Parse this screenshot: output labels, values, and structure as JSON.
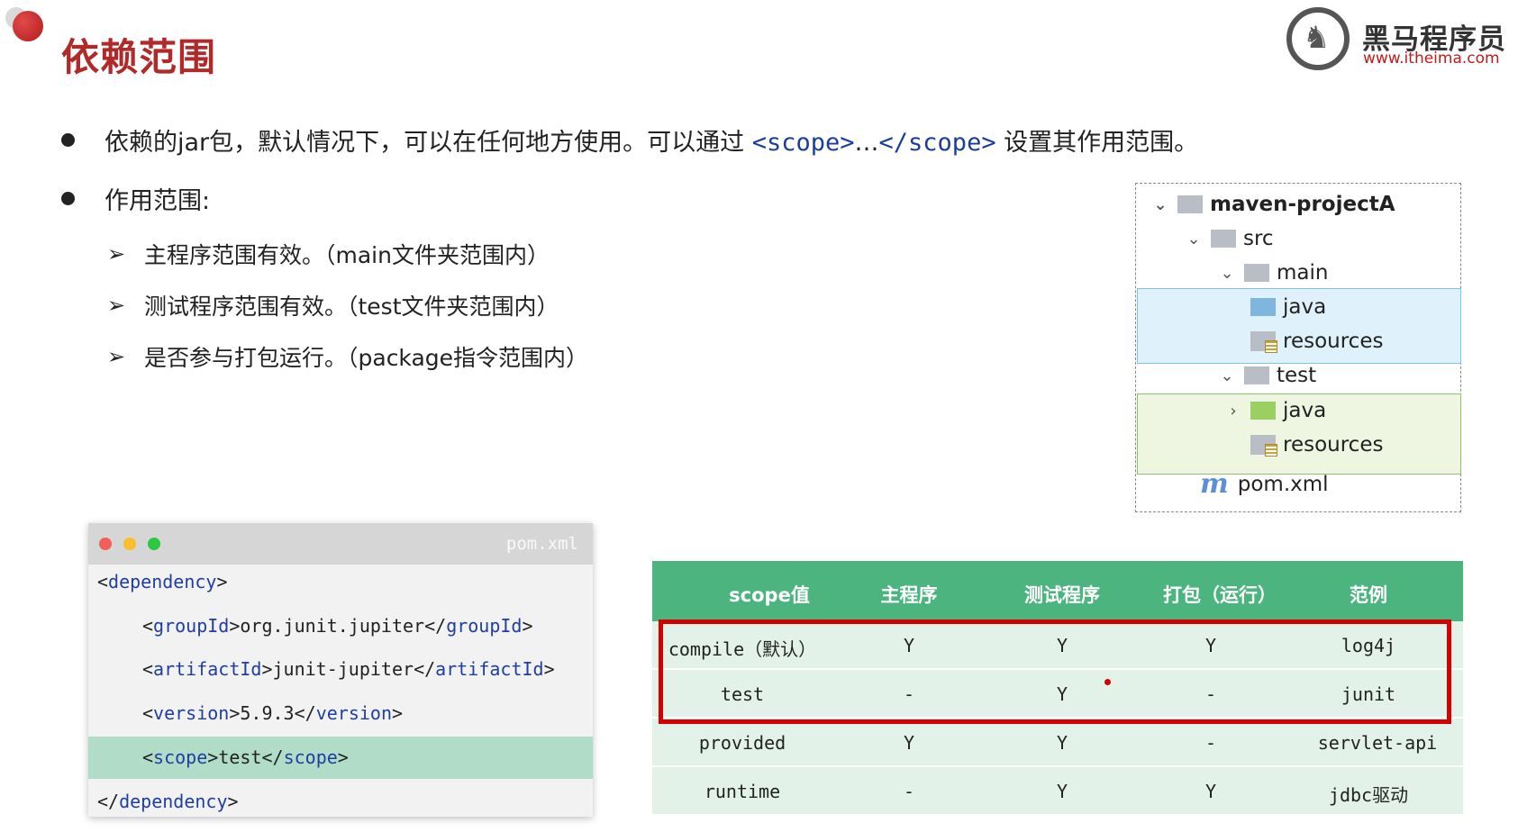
{
  "header": {
    "title": "依赖范围",
    "logo_cn": "黑马程序员",
    "logo_url": "www.itheima.com"
  },
  "bullets": [
    {
      "prefix": "依赖的jar包，默认情况下，可以在任何地方使用。可以通过 ",
      "tag1": "<scope>",
      "mid": "…",
      "tag2": "</scope>",
      "suffix": " 设置其作用范围。"
    },
    {
      "text": "作用范围:"
    }
  ],
  "sub_items": [
    "主程序范围有效。（main文件夹范围内）",
    "测试程序范围有效。（test文件夹范围内）",
    "是否参与打包运行。（package指令范围内）"
  ],
  "tree": {
    "project": "maven-projectA",
    "src": "src",
    "main": "main",
    "main_java": "java",
    "main_resources": "resources",
    "test": "test",
    "test_java": "java",
    "test_resources": "resources",
    "pom": "pom.xml",
    "pom_letter": "m"
  },
  "code": {
    "filename": "pom.xml",
    "lines": [
      {
        "open": "<",
        "tag": "dependency",
        "close": ">",
        "text": "",
        "end_open": "",
        "end_tag": "",
        "end_close": ""
      },
      {
        "open": "<",
        "tag": "groupId",
        "close": ">",
        "text": "org.junit.jupiter",
        "end_open": "</",
        "end_tag": "groupId",
        "end_close": ">"
      },
      {
        "open": "<",
        "tag": "artifactId",
        "close": ">",
        "text": "junit-jupiter",
        "end_open": "</",
        "end_tag": "artifactId",
        "end_close": ">"
      },
      {
        "open": "<",
        "tag": "version",
        "close": ">",
        "text": "5.9.3",
        "end_open": "</",
        "end_tag": "version",
        "end_close": ">"
      },
      {
        "open": "<",
        "tag": "scope",
        "close": ">",
        "text": "test",
        "end_open": "</",
        "end_tag": "scope",
        "end_close": ">"
      },
      {
        "open": "</",
        "tag": "dependency",
        "close": ">",
        "text": "",
        "end_open": "",
        "end_tag": "",
        "end_close": ""
      }
    ]
  },
  "table": {
    "headers": [
      "scope值",
      "主程序",
      "测试程序",
      "打包（运行）",
      "范例"
    ],
    "rows": [
      [
        "compile（默认）",
        "Y",
        "Y",
        "Y",
        "log4j"
      ],
      [
        "test",
        "-",
        "Y",
        "-",
        "junit"
      ],
      [
        "provided",
        "Y",
        "Y",
        "-",
        "servlet-api"
      ],
      [
        "runtime",
        "-",
        "Y",
        "Y",
        "jdbc驱动"
      ]
    ],
    "highlight_color": "#d40000",
    "header_color": "#4cb57f"
  }
}
